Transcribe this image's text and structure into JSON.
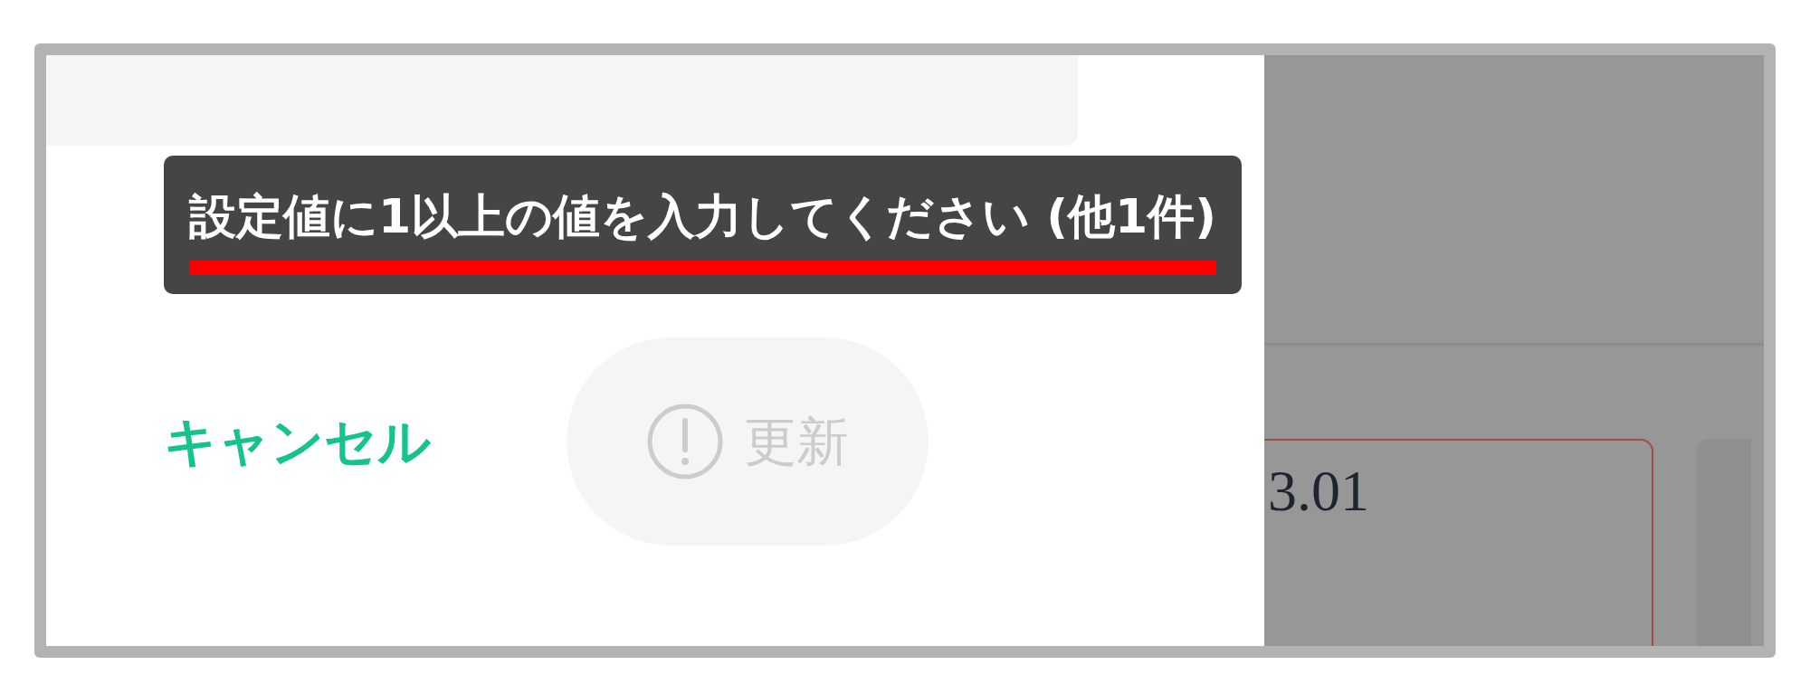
{
  "tooltip": {
    "text": "設定値に1以上の値を入力してください (他1件)",
    "underlined": true
  },
  "dialog": {
    "buttons": [
      {
        "label": "キャンセル",
        "kind": "text",
        "disabled": false
      },
      {
        "label": "更新",
        "kind": "pill",
        "disabled": true
      }
    ]
  },
  "background": {
    "card_value": "3.01"
  }
}
